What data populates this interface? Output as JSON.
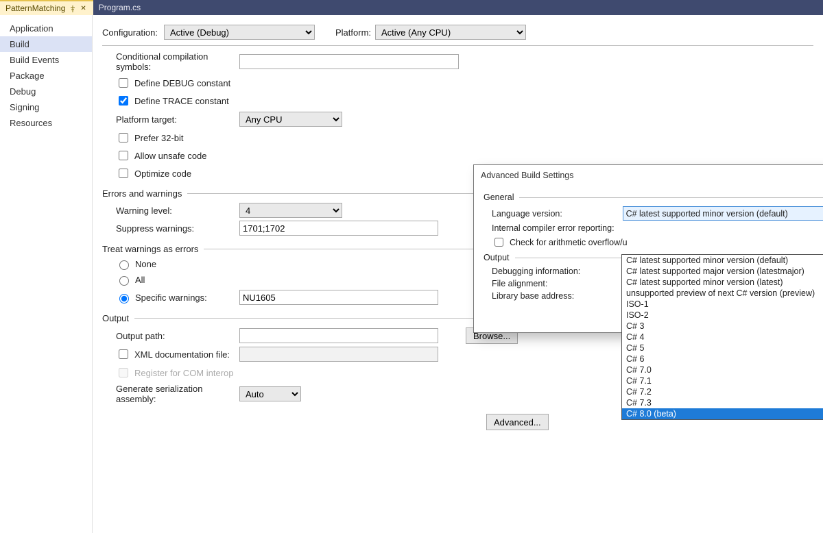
{
  "tabs": {
    "active": "PatternMatching",
    "inactive": "Program.cs"
  },
  "sidenav": [
    "Application",
    "Build",
    "Build Events",
    "Package",
    "Debug",
    "Signing",
    "Resources"
  ],
  "header": {
    "configuration_label": "Configuration:",
    "configuration_value": "Active (Debug)",
    "platform_label": "Platform:",
    "platform_value": "Active (Any CPU)"
  },
  "general": {
    "cond_sym_label": "Conditional compilation symbols:",
    "cond_sym_value": "",
    "debug_const": "Define DEBUG constant",
    "trace_const": "Define TRACE constant",
    "platform_target_label": "Platform target:",
    "platform_target_value": "Any CPU",
    "prefer32": "Prefer 32-bit",
    "unsafe": "Allow unsafe code",
    "optimize": "Optimize code"
  },
  "errors": {
    "section": "Errors and warnings",
    "warning_level_label": "Warning level:",
    "warning_level_value": "4",
    "suppress_label": "Suppress warnings:",
    "suppress_value": "1701;1702"
  },
  "treat": {
    "section": "Treat warnings as errors",
    "none": "None",
    "all": "All",
    "specific": "Specific warnings:",
    "specific_value": "NU1605"
  },
  "output": {
    "section": "Output",
    "outpath_label": "Output path:",
    "outpath_value": "",
    "browse": "Browse...",
    "xml_doc": "XML documentation file:",
    "xml_doc_value": "",
    "com": "Register for COM interop",
    "gensa_label": "Generate serialization assembly:",
    "gensa_value": "Auto",
    "advanced_btn": "Advanced..."
  },
  "dialog": {
    "title": "Advanced Build Settings",
    "general_section": "General",
    "lang_label": "Language version:",
    "lang_value": "C# latest supported minor version (default)",
    "internal_label": "Internal compiler error reporting:",
    "arith_label": "Check for arithmetic overflow/u",
    "output_section": "Output",
    "debuginfo_label": "Debugging information:",
    "filealign_label": "File alignment:",
    "libbase_label": "Library base address:",
    "lang_options": [
      "C# latest supported minor version (default)",
      "C# latest supported major version (latestmajor)",
      "C# latest supported minor version (latest)",
      "unsupported preview of next C# version (preview)",
      "ISO-1",
      "ISO-2",
      "C# 3",
      "C# 4",
      "C# 5",
      "C# 6",
      "C# 7.0",
      "C# 7.1",
      "C# 7.2",
      "C# 7.3",
      "C# 8.0 (beta)"
    ],
    "selected_option": "C# 8.0 (beta)"
  }
}
